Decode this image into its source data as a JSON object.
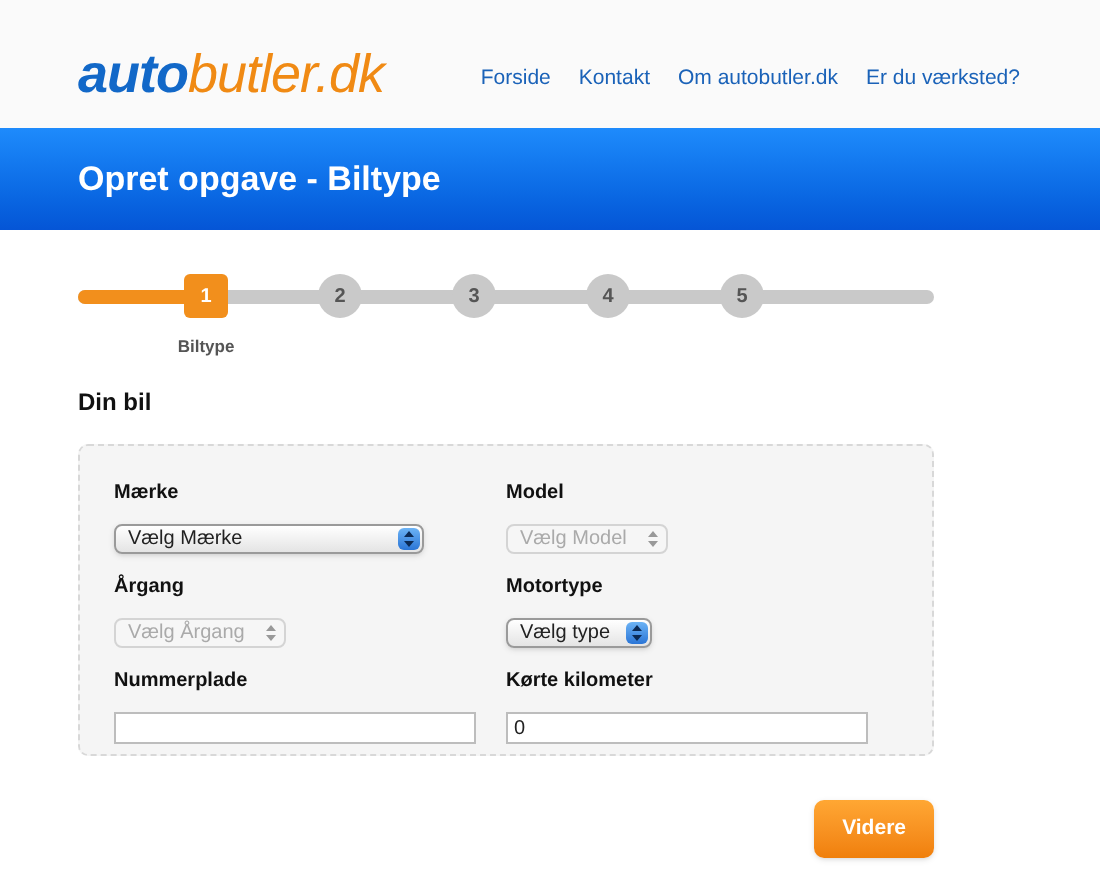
{
  "header": {
    "logo": {
      "part_1": "auto",
      "part_2": "butler.dk"
    },
    "nav": [
      "Forside",
      "Kontakt",
      "Om autobutler.dk",
      "Er du værksted?"
    ]
  },
  "banner": {
    "title": "Opret opgave - Biltype"
  },
  "stepper": {
    "level": 0.15,
    "steps": [
      {
        "label": "1",
        "caption": "Biltype",
        "selected": true
      },
      {
        "label": "2",
        "selected": false
      },
      {
        "label": "3",
        "selected": false
      },
      {
        "label": "4",
        "selected": false
      },
      {
        "label": "5",
        "selected": false
      }
    ]
  },
  "section_title": "Din bil",
  "fields": [
    {
      "kind": "select",
      "label": "Mærke",
      "value": "Vælg Mærke",
      "disabled": false,
      "wide": true
    },
    {
      "kind": "select",
      "label": "Model",
      "value": "Vælg Model",
      "disabled": true,
      "wide": false
    },
    {
      "kind": "select",
      "label": "Årgang",
      "value": "Vælg Årgang",
      "disabled": true,
      "wide": false
    },
    {
      "kind": "select",
      "label": "Motortype",
      "value": "Vælg type",
      "disabled": false,
      "wide": false
    },
    {
      "kind": "text",
      "label": "Nummerplade"
    },
    {
      "kind": "text",
      "label": "Kørte kilometer",
      "value": "0"
    }
  ],
  "submit": "Videre"
}
